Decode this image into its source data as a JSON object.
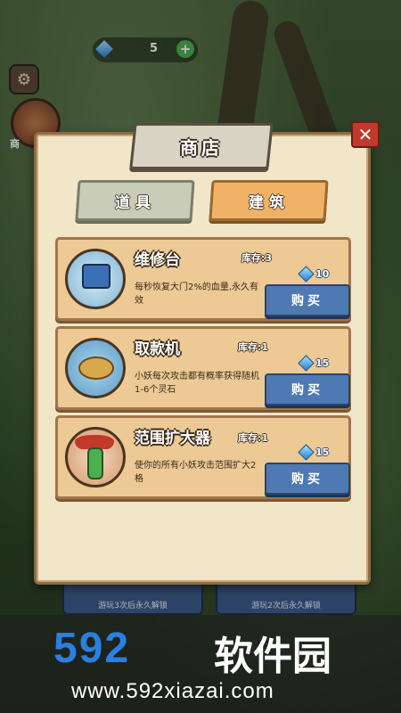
{
  "hud": {
    "gem_count": "5",
    "plus_label": "+",
    "settings_icon": "gear-icon",
    "side_icon_label": "商"
  },
  "dialog": {
    "title": "商店",
    "close_label": "✕",
    "tabs": [
      {
        "label": "道具",
        "active": false
      },
      {
        "label": "建筑",
        "active": true
      }
    ],
    "stock_prefix": "库存:",
    "buy_label": "购买",
    "items": [
      {
        "name": "维修台",
        "stock": "3",
        "price": "10",
        "desc": "每秒恢复大门2%的血量,永久有效",
        "icon": "repair-station-icon"
      },
      {
        "name": "取款机",
        "stock": "1",
        "price": "15",
        "desc": "小妖每次攻击都有概率获得随机1-6个灵石",
        "icon": "atm-icon"
      },
      {
        "name": "范围扩大器",
        "stock": "1",
        "price": "15",
        "desc": "使你的所有小妖攻击范围扩大2格",
        "icon": "range-expander-icon"
      }
    ]
  },
  "background_cards": [
    "游玩3次后永久解锁",
    "游玩2次后永久解锁"
  ],
  "watermark": {
    "logo_digits": "592",
    "logo_text": "软件园",
    "url": "www.592xiazai.com"
  },
  "colors": {
    "panel": "#f2e6c9",
    "item_card": "#ecc995",
    "buy_button": "#4f79b3",
    "active_tab": "#f0b266",
    "close_button": "#c0392b"
  }
}
